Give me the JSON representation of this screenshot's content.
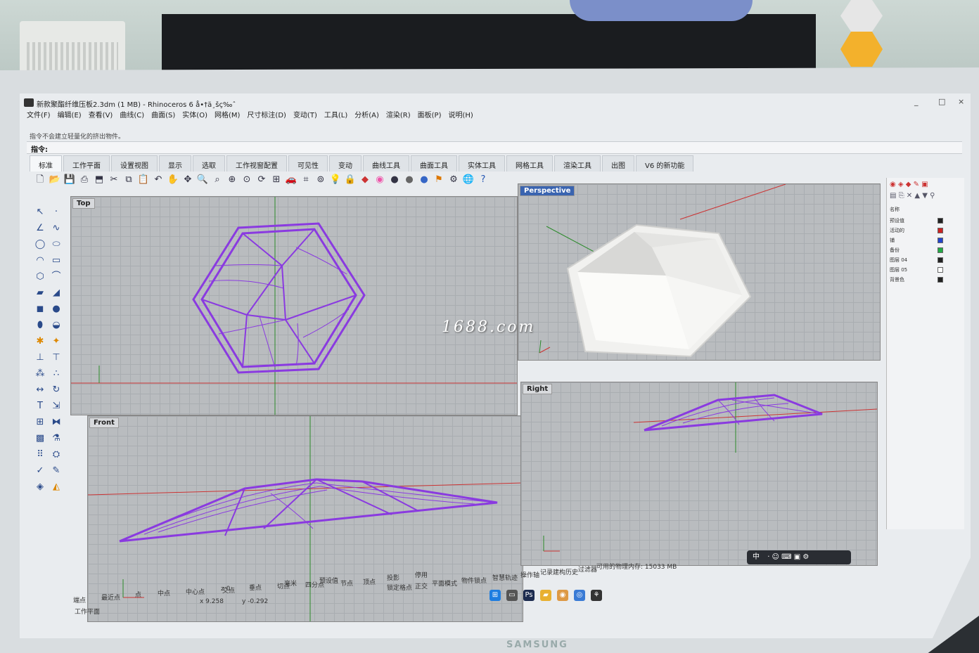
{
  "window": {
    "title": "新款聚酯纤维压板2.3dm (1 MB) - Rhinoceros 6 å•†ä¸šç‰ˆ",
    "controls": [
      "_",
      "□",
      "×"
    ]
  },
  "menu": [
    "文件(F)",
    "编辑(E)",
    "查看(V)",
    "曲线(C)",
    "曲面(S)",
    "实体(O)",
    "网格(M)",
    "尺寸标注(D)",
    "变动(T)",
    "工具(L)",
    "分析(A)",
    "渲染(R)",
    "面板(P)",
    "说明(H)"
  ],
  "command": {
    "history_line": "指令不会建立轻量化的挤出物件。",
    "prompt_label": "指令:"
  },
  "tabs": [
    "标准",
    "工作平面",
    "设置视图",
    "显示",
    "选取",
    "工作视窗配置",
    "可见性",
    "变动",
    "曲线工具",
    "曲面工具",
    "实体工具",
    "网格工具",
    "渲染工具",
    "出图",
    "V6 的新功能"
  ],
  "toolbar_icons": [
    "new-file-icon",
    "open-folder-icon",
    "save-icon",
    "print-icon",
    "import-icon",
    "cut-icon",
    "copy-icon",
    "paste-icon",
    "undo-icon",
    "pan-icon",
    "move-icon",
    "zoom-icon",
    "zoom-window-icon",
    "zoom-extents-icon",
    "zoom-selected-icon",
    "rotate-view-icon",
    "four-views-icon",
    "car-icon",
    "grid-icon",
    "point-icon",
    "light-bulb-icon",
    "lock-icon",
    "layer-color-icon",
    "color-wheel-icon",
    "sphere-shade-icon",
    "sphere-render-icon",
    "sphere-blue-icon",
    "flag-icon",
    "gear-icon",
    "globe-icon",
    "help-icon"
  ],
  "viewports": {
    "top": {
      "label": "Top"
    },
    "perspective": {
      "label": "Perspective"
    },
    "front": {
      "label": "Front"
    },
    "right": {
      "label": "Right"
    }
  },
  "watermark": "1688.com",
  "layers": {
    "header": "名称",
    "rows": [
      {
        "name": "预设值",
        "color": "#222222"
      },
      {
        "name": "活动的",
        "color": "#cc2222"
      },
      {
        "name": "铺",
        "color": "#2244cc"
      },
      {
        "name": "备份",
        "color": "#22aa44"
      },
      {
        "name": "图层 04",
        "color": "#222222"
      },
      {
        "name": "图层 05",
        "color": "#ffffff"
      },
      {
        "name": "背景色",
        "color": "#222222"
      }
    ]
  },
  "status": {
    "osnaps_row1": [
      "端点",
      "最近点",
      "点",
      "中点",
      "中心点",
      "交点",
      "垂点",
      "切点",
      "四分点",
      "节点",
      "顶点"
    ],
    "projection": "投影",
    "disable": "停用",
    "cplane": "工作平面",
    "x": "x 9.258",
    "y": "y -0.292",
    "z": "z 0",
    "unit": "毫米",
    "layer": "预设值",
    "modes": [
      "锁定格点",
      "正交",
      "平面模式",
      "物件锁点",
      "智慧轨迹",
      "操作轴",
      "记录建构历史",
      "过滤器"
    ],
    "memory": "可用的物理内存: 15033 MB"
  },
  "ime": {
    "label": "中"
  },
  "brand": "SAMSUNG"
}
